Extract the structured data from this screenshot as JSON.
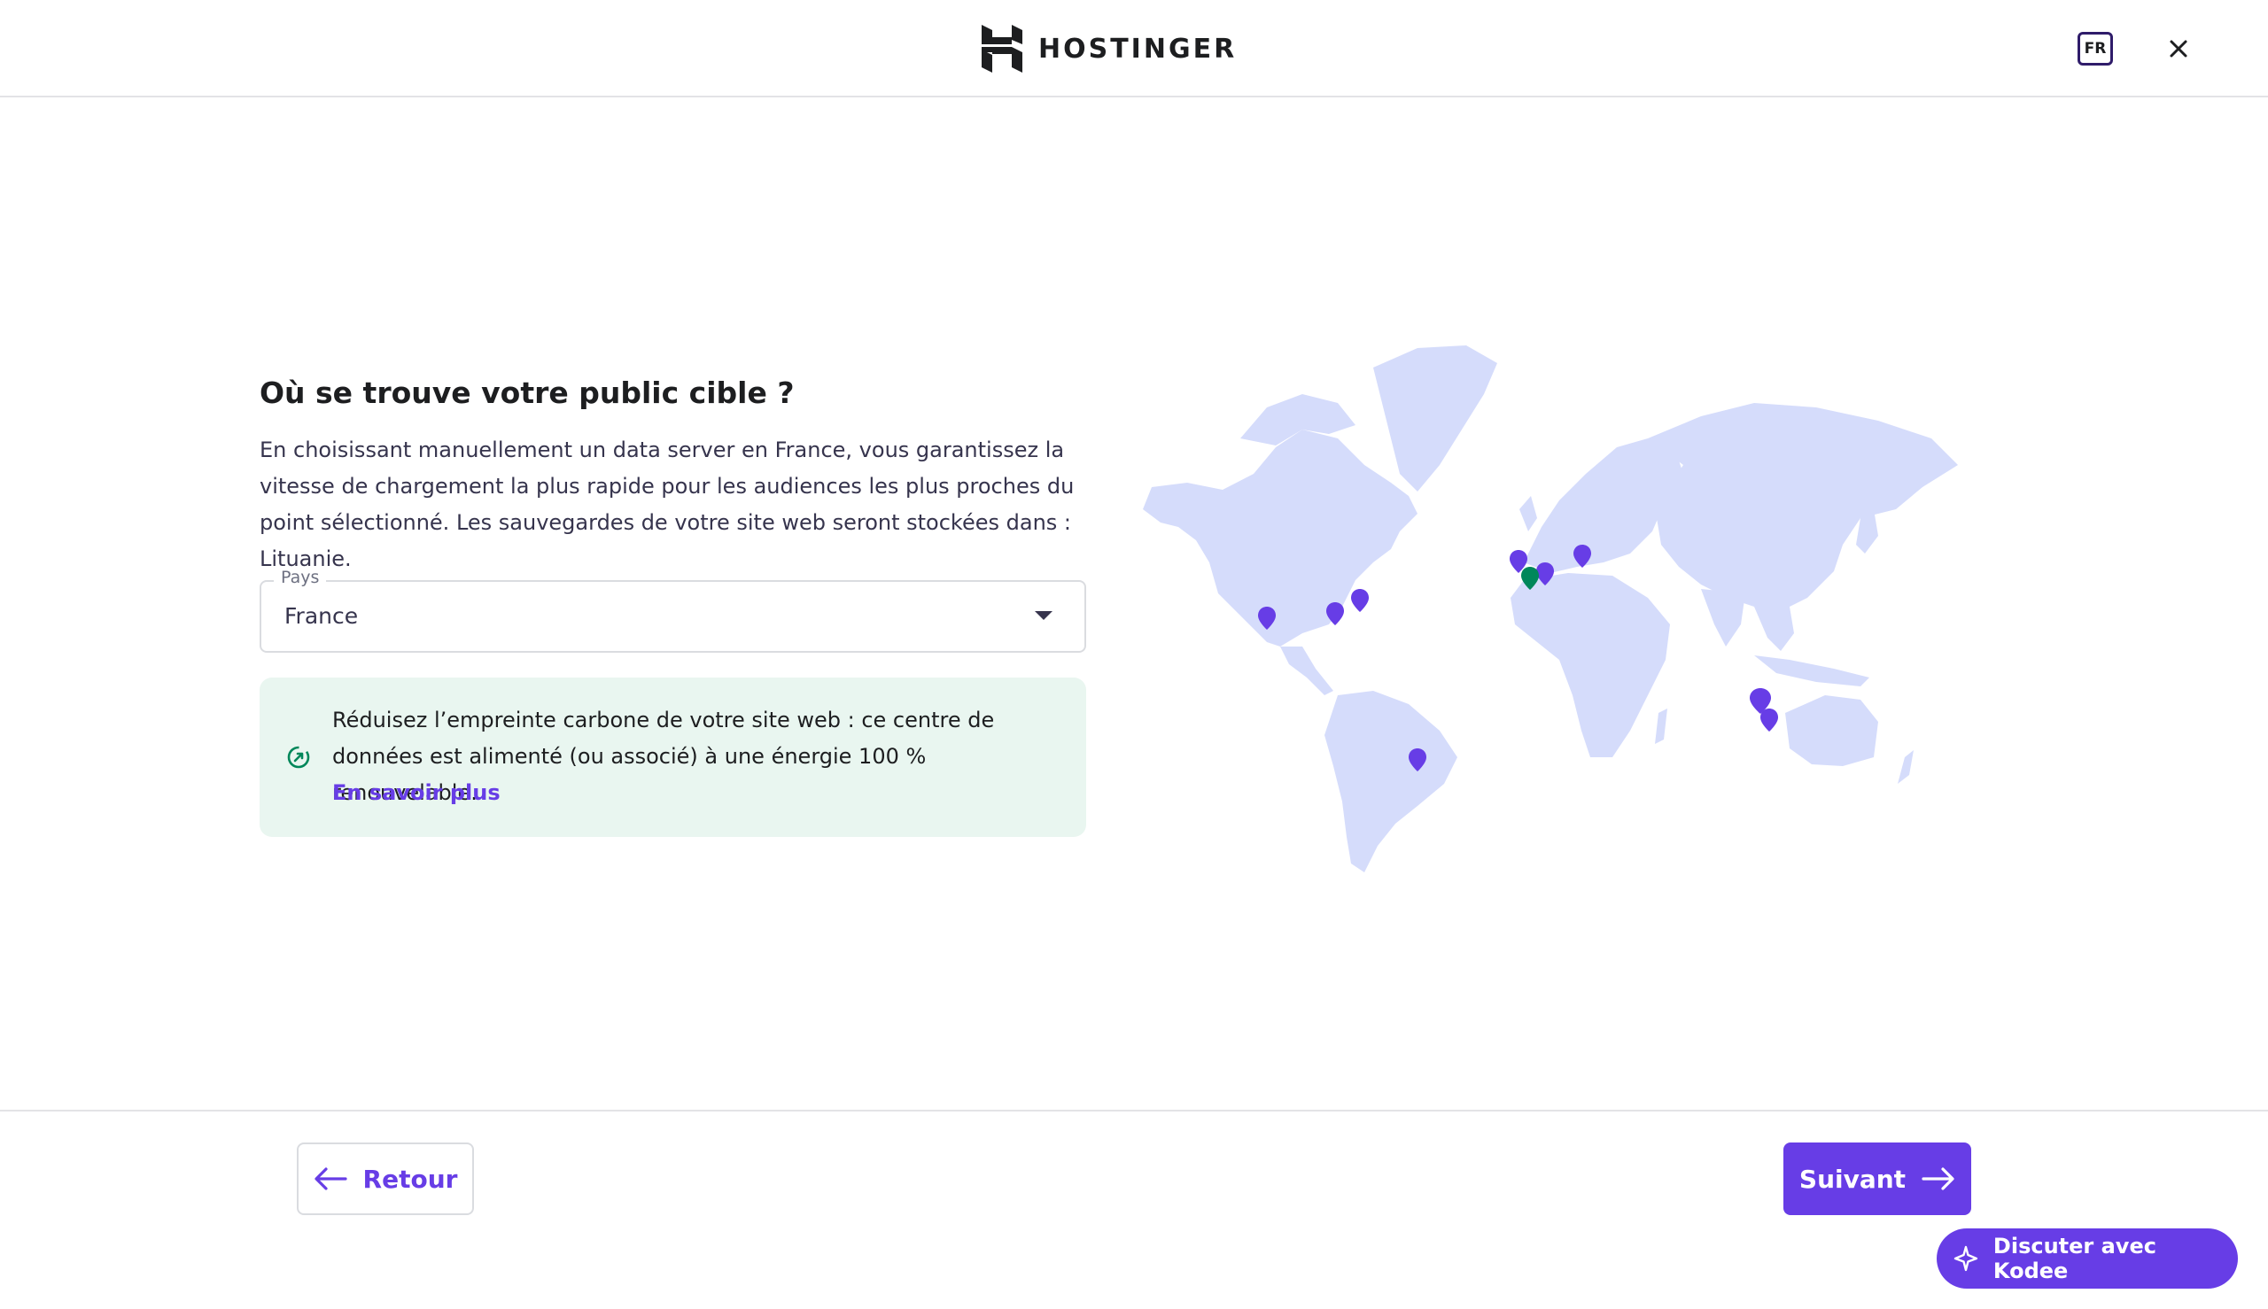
{
  "header": {
    "brand": "HOSTINGER",
    "language": "FR"
  },
  "main": {
    "title": "Où se trouve votre public cible ?",
    "description": "En choisissant manuellement un data server en France, vous garantissez la vitesse de chargement la plus rapide pour les audiences les plus proches du point sélectionné. Les sauvegardes de votre site web seront stockées dans : Lituanie.",
    "country_field": {
      "label": "Pays",
      "value": "France"
    },
    "eco_notice": {
      "text": "Réduisez l’empreinte carbone de votre site web : ce centre de données est alimenté (ou associé) à une énergie 100 % renouvelable.",
      "link": "En savoir plus"
    }
  },
  "footer": {
    "back_label": "Retour",
    "next_label": "Suivant",
    "chat_label": "Discuter avec Kodee"
  },
  "colors": {
    "accent": "#673de6",
    "selected_marker": "#00875a",
    "map_land": "#d5dcfb",
    "eco_background": "#e9f6f0"
  }
}
